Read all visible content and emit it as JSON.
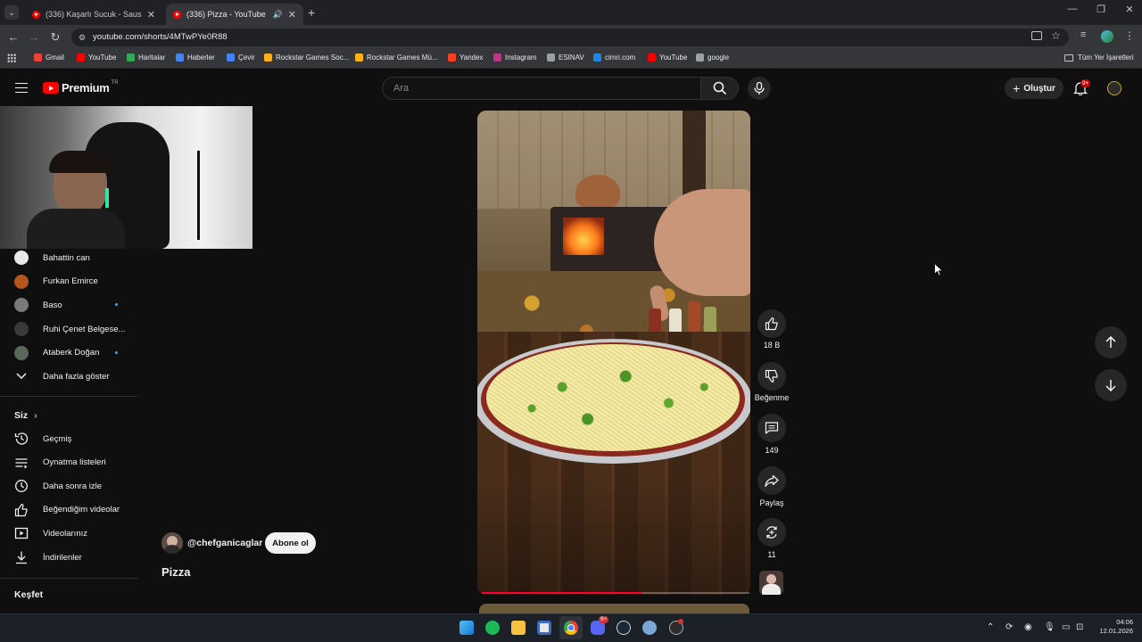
{
  "browser": {
    "tabs": [
      {
        "title": "(336) Kaşarlı Sucuk - Sausage W",
        "active": false
      },
      {
        "title": "(336) Pizza - YouTube",
        "active": true
      }
    ],
    "url": "youtube.com/shorts/4MTwPYe0R88",
    "bookmarks": [
      {
        "label": "Gmail",
        "color": "#ea4335"
      },
      {
        "label": "YouTube",
        "color": "#ff0000"
      },
      {
        "label": "Haritalar",
        "color": "#34a853"
      },
      {
        "label": "Haberler",
        "color": "#4285f4"
      },
      {
        "label": "Çevir",
        "color": "#4285f4"
      },
      {
        "label": "Rockstar Games Soc...",
        "color": "#fcaf17"
      },
      {
        "label": "Rockstar Games Mü...",
        "color": "#fcaf17"
      },
      {
        "label": "Yandex",
        "color": "#fc3f1d"
      },
      {
        "label": "Instagram",
        "color": "#c13584"
      },
      {
        "label": "ESINAV",
        "color": "#9aa0a6"
      },
      {
        "label": "cimri.com",
        "color": "#1e88e5"
      },
      {
        "label": "YouTube",
        "color": "#ff0000"
      },
      {
        "label": "google",
        "color": "#9aa0a6"
      }
    ],
    "all_bookmarks": "Tüm Yer İşaretleri"
  },
  "header": {
    "logo_text": "Premium",
    "logo_region": "TR",
    "search_placeholder": "Ara",
    "create_label": "Oluştur",
    "notification_count": "9+"
  },
  "sidebar": {
    "subscriptions": [
      {
        "name": "Bahattin can",
        "avatar_color": "#e8e8e8",
        "new": false
      },
      {
        "name": "Furkan Emirce",
        "avatar_color": "#b5541c",
        "new": false
      },
      {
        "name": "Baso",
        "avatar_color": "#7a7a7a",
        "new": true
      },
      {
        "name": "Ruhi Çenet Belgese...",
        "avatar_color": "#3a3a3a",
        "new": false
      },
      {
        "name": "Ataberk Doğan",
        "avatar_color": "#5a6a5a",
        "new": true
      }
    ],
    "show_more": "Daha fazla göster",
    "you_title": "Siz",
    "you_items": [
      {
        "label": "Geçmiş",
        "icon": "history-icon"
      },
      {
        "label": "Oynatma listeleri",
        "icon": "playlist-icon"
      },
      {
        "label": "Daha sonra izle",
        "icon": "watch-later-icon"
      },
      {
        "label": "Beğendiğim videolar",
        "icon": "liked-icon"
      },
      {
        "label": "Videolarınız",
        "icon": "your-videos-icon"
      },
      {
        "label": "İndirilenler",
        "icon": "download-icon"
      }
    ],
    "explore_title": "Keşfet"
  },
  "short": {
    "channel": "@chefganicaglar",
    "subscribe_label": "Abone ol",
    "title": "Pizza",
    "progress": 0.6,
    "likes": "18 B",
    "dislike_label": "Beğenme",
    "comments": "149",
    "share_label": "Paylaş",
    "remix_count": "11"
  },
  "taskbar": {
    "time": "04:06",
    "date": "12.01.2026",
    "discord_badge": "9+"
  }
}
